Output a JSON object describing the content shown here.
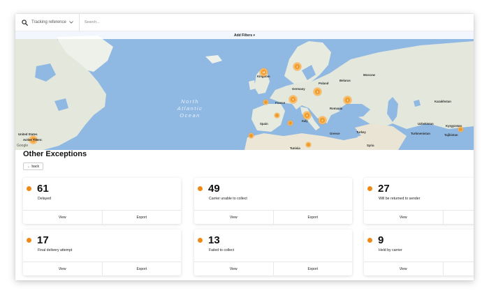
{
  "search": {
    "type_label": "Tracking reference",
    "placeholder": "Search..."
  },
  "map": {
    "add_filters": "Add Filters ▾",
    "ocean_lines": [
      "North",
      "Atlantic",
      "Ocean"
    ],
    "places": {
      "kingdom": "Kingdom",
      "germany": "Germany",
      "poland": "Poland",
      "belarus": "Belarus",
      "france": "France",
      "romania": "Romania",
      "italy": "Italy",
      "spain": "Spain",
      "turkey": "Turkey",
      "greece": "Greece",
      "syria": "Syria",
      "kazakhstan": "Kazakhstan",
      "uzbekistan": "Uzbekistan",
      "turkmenistan": "Turkmenistan",
      "tajikistan": "Tajikistan",
      "kyrgyzstan": "Kyrgyzstan",
      "united_states": "United States",
      "moscow": "Moscow",
      "tunisia": "Tunisia"
    },
    "markers": [
      "18",
      "2",
      "5",
      "4",
      "3",
      "3",
      "4",
      "6",
      "8",
      "11"
    ],
    "google": "Google"
  },
  "active_filters_label": "Active Filters:",
  "page_title": "Other Exceptions",
  "back_label": "← back",
  "accent_color": "#ef8a17",
  "cards": [
    {
      "count": "61",
      "label": "Delayed",
      "view": "View",
      "export": "Export"
    },
    {
      "count": "49",
      "label": "Carrier unable to collect",
      "view": "View",
      "export": "Export"
    },
    {
      "count": "27",
      "label": "Will be returned to sender",
      "view": "View"
    },
    {
      "count": "17",
      "label": "Final delivery attempt",
      "view": "View",
      "export": "Export"
    },
    {
      "count": "13",
      "label": "Failed to collect",
      "view": "View",
      "export": "Export"
    },
    {
      "count": "9",
      "label": "Held by carrier",
      "view": "View"
    }
  ]
}
